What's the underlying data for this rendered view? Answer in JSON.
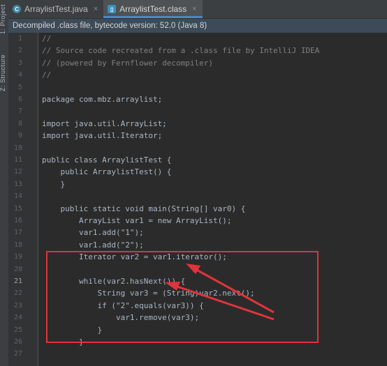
{
  "side_tool_labels": [
    "1: Project",
    "Z: Structure"
  ],
  "tabs": [
    {
      "label": "ArraylistTest.java",
      "icon": "java-class-icon",
      "active": false
    },
    {
      "label": "ArraylistTest.class",
      "icon": "compiled-class-icon",
      "active": true
    }
  ],
  "close_glyph": "×",
  "banner_text": "Decompiled .class file, bytecode version: 52.0 (Java 8)",
  "line_numbers": [
    "1",
    "2",
    "3",
    "4",
    "5",
    "6",
    "7",
    "8",
    "9",
    "10",
    "11",
    "12",
    "13",
    "14",
    "15",
    "16",
    "17",
    "18",
    "19",
    "20",
    "21",
    "22",
    "23",
    "24",
    "25",
    "26",
    "27"
  ],
  "current_line": 21,
  "code_lines": [
    "//",
    "// Source code recreated from a .class file by IntelliJ IDEA",
    "// (powered by Fernflower decompiler)",
    "//",
    "",
    "package com.mbz.arraylist;",
    "",
    "import java.util.ArrayList;",
    "import java.util.Iterator;",
    "",
    "public class ArraylistTest {",
    "    public ArraylistTest() {",
    "    }",
    "",
    "    public static void main(String[] var0) {",
    "        ArrayList var1 = new ArrayList();",
    "        var1.add(\"1\");",
    "        var1.add(\"2\");",
    "        Iterator var2 = var1.iterator();",
    "",
    "        while(var2.hasNext()) {",
    "            String var3 = (String)var2.next();",
    "            if (\"2\".equals(var3)) {",
    "                var1.remove(var3);",
    "            }",
    "        }",
    ""
  ],
  "colors": {
    "background": "#2B2B2B",
    "code_text": "#A9B7C6",
    "comment": "#808080",
    "annotation_red": "#E0343A",
    "active_tab_accent": "#4A88C7"
  }
}
